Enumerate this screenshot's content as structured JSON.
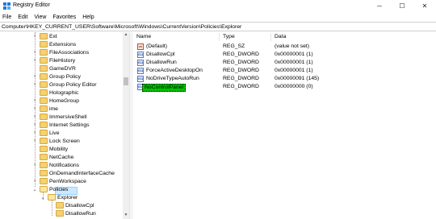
{
  "window": {
    "title": "Registry Editor",
    "minimize": "─",
    "maximize": "☐",
    "close": "✕"
  },
  "menu": [
    "File",
    "Edit",
    "View",
    "Favorites",
    "Help"
  ],
  "address": "Computer\\HKEY_CURRENT_USER\\Software\\Microsoft\\Windows\\CurrentVersion\\Policies\\Explorer",
  "tree": {
    "items": [
      {
        "label": "Ext"
      },
      {
        "label": "Extensions"
      },
      {
        "label": "FileAssociations"
      },
      {
        "label": "FileHistory"
      },
      {
        "label": "GameDVR"
      },
      {
        "label": "Group Policy"
      },
      {
        "label": "Group Policy Editor"
      },
      {
        "label": "Holographic"
      },
      {
        "label": "HomeGroup"
      },
      {
        "label": "ime"
      },
      {
        "label": "ImmersiveShell"
      },
      {
        "label": "Internet Settings"
      },
      {
        "label": "Live"
      },
      {
        "label": "Lock Screen"
      },
      {
        "label": "Mobility"
      },
      {
        "label": "NetCache"
      },
      {
        "label": "Notifications"
      },
      {
        "label": "OnDemandInterfaceCache"
      },
      {
        "label": "PenWorkspace"
      },
      {
        "label": "Policies"
      },
      {
        "label": "Explorer"
      },
      {
        "label": "DisallowCpl"
      },
      {
        "label": "DisallowRun"
      }
    ]
  },
  "list": {
    "headers": {
      "name": "Name",
      "type": "Type",
      "data": "Data"
    },
    "rows": [
      {
        "icon": "ab",
        "name": "(Default)",
        "type": "REG_SZ",
        "data": "(value not set)"
      },
      {
        "icon": "011",
        "name": "DisallowCpl",
        "type": "REG_DWORD",
        "data": "0x00000001 (1)"
      },
      {
        "icon": "011",
        "name": "DisallowRun",
        "type": "REG_DWORD",
        "data": "0x00000001 (1)"
      },
      {
        "icon": "011",
        "name": "ForceActiveDesktopOn",
        "type": "REG_DWORD",
        "data": "0x00000001 (1)"
      },
      {
        "icon": "011",
        "name": "NoDriveTypeAutoRun",
        "type": "REG_DWORD",
        "data": "0x00000091 (145)"
      },
      {
        "icon": "011",
        "name": "NoControlPanel",
        "type": "REG_DWORD",
        "data": "0x00000000 (0)"
      }
    ]
  },
  "colors": {
    "selected_value_highlight": "#00c300",
    "tree_selection": "#cce8ff",
    "folder": "#f4d171"
  },
  "icons": {
    "app": "registry-editor-icon",
    "folder": "folder-icon",
    "string_value": "reg-sz-icon",
    "dword_value": "reg-dword-icon"
  }
}
